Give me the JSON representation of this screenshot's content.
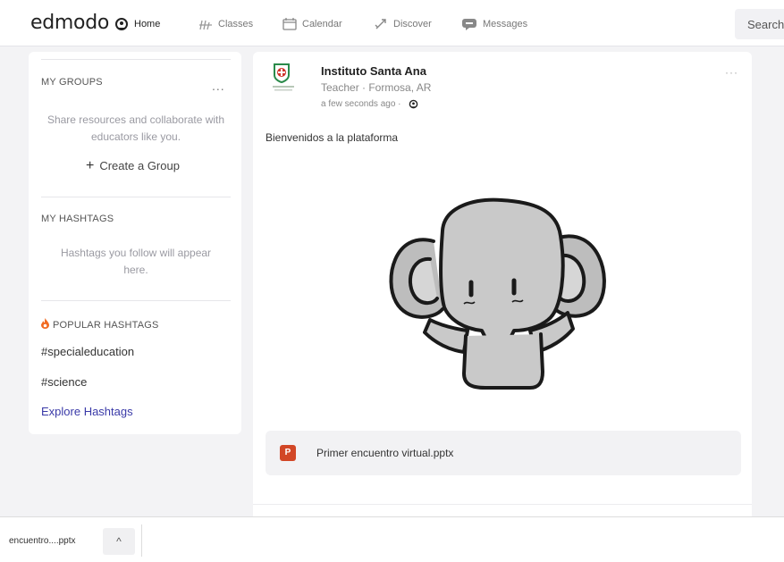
{
  "app": {
    "logo": "edmodo"
  },
  "nav": [
    {
      "label": "Home",
      "icon": "home-icon"
    },
    {
      "label": "Classes",
      "icon": "classes-icon"
    },
    {
      "label": "Calendar",
      "icon": "calendar-icon"
    },
    {
      "label": "Discover",
      "icon": "discover-icon"
    },
    {
      "label": "Messages",
      "icon": "messages-icon"
    }
  ],
  "search": {
    "placeholder": "Search"
  },
  "sidebar": {
    "groups_title": "MY GROUPS",
    "groups_more": "...",
    "groups_empty": "Share resources and collaborate with educators like you.",
    "create_group": "Create a Group",
    "hashtags_title": "MY HASHTAGS",
    "hashtags_empty": "Hashtags you follow will appear here.",
    "popular_title": "POPULAR HASHTAGS",
    "popular": [
      "#specialeducation",
      "#science"
    ],
    "explore": "Explore Hashtags"
  },
  "post": {
    "author": "Instituto Santa Ana",
    "role": "Teacher · Formosa, AR",
    "time": "a few seconds ago ·",
    "more": "···",
    "text": "Bienvenidos a la plataforma",
    "attachment": {
      "name": "Primer encuentro virtual.pptx",
      "icon_letter": "P"
    }
  },
  "download_bar": {
    "file": "encuentro....pptx",
    "chevron": "^"
  },
  "colors": {
    "accent": "#3a3aa8",
    "flame": "#f26b21",
    "ppt": "#d24726"
  }
}
